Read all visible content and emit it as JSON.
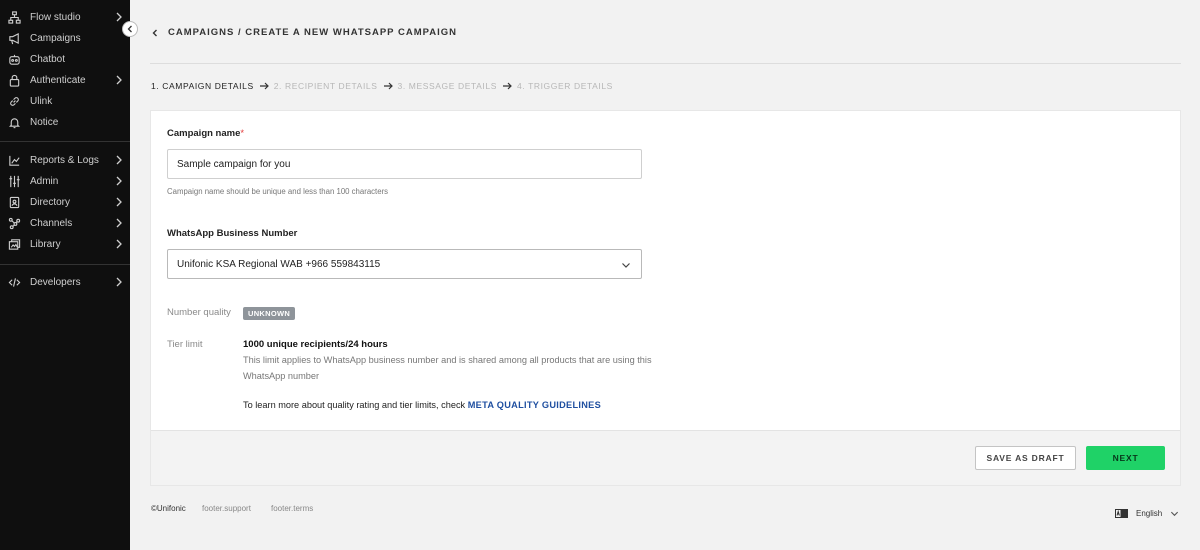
{
  "sidebar": {
    "items": [
      {
        "label": "Flow studio",
        "icon": "flow-icon",
        "chevron": true
      },
      {
        "label": "Campaigns",
        "icon": "megaphone-icon",
        "chevron": false
      },
      {
        "label": "Chatbot",
        "icon": "bot-icon",
        "chevron": false
      },
      {
        "label": "Authenticate",
        "icon": "lock-icon",
        "chevron": true
      },
      {
        "label": "Ulink",
        "icon": "link-icon",
        "chevron": false
      },
      {
        "label": "Notice",
        "icon": "bell-icon",
        "chevron": false
      },
      {
        "label": "Reports & Logs",
        "icon": "chart-icon",
        "chevron": true
      },
      {
        "label": "Admin",
        "icon": "sliders-icon",
        "chevron": true
      },
      {
        "label": "Directory",
        "icon": "contact-book-icon",
        "chevron": true
      },
      {
        "label": "Channels",
        "icon": "nodes-icon",
        "chevron": true
      },
      {
        "label": "Library",
        "icon": "library-icon",
        "chevron": true
      },
      {
        "label": "Developers",
        "icon": "code-icon",
        "chevron": true
      }
    ]
  },
  "header": {
    "title": "CAMPAIGNS / CREATE A NEW WHATSAPP CAMPAIGN"
  },
  "steps": [
    {
      "label": "1. CAMPAIGN DETAILS",
      "active": true
    },
    {
      "label": "2. RECIPIENT DETAILS",
      "active": false
    },
    {
      "label": "3. MESSAGE DETAILS",
      "active": false
    },
    {
      "label": "4. TRIGGER DETAILS",
      "active": false
    }
  ],
  "form": {
    "campaign_name_label": "Campaign name",
    "required_marker": "*",
    "campaign_name_value": "Sample campaign for you",
    "campaign_name_hint": "Campaign name should be unique and less than 100 characters",
    "business_number_label": "WhatsApp Business Number",
    "business_number_value": "Unifonic KSA Regional WAB +966 559843115",
    "number_quality_label": "Number quality",
    "number_quality_badge": "UNKNOWN",
    "tier_limit_label": "Tier limit",
    "tier_limit_value": "1000 unique recipients/24 hours",
    "tier_limit_desc": "This limit applies to WhatsApp business number and is shared among all products that are using this WhatsApp number",
    "learn_more_text": "To learn more about quality rating and tier limits, check",
    "learn_more_link": "META QUALITY GUIDELINES"
  },
  "actions": {
    "save_draft": "SAVE AS DRAFT",
    "next": "NEXT"
  },
  "footer": {
    "copyright": "©Unifonic",
    "support": "footer.support",
    "terms": "footer.terms",
    "language": "English"
  },
  "colors": {
    "sidebar_bg": "#0f0f0f",
    "accent_green": "#1fd267",
    "link_blue": "#1f4fa0",
    "badge_gray": "#8e949a"
  }
}
